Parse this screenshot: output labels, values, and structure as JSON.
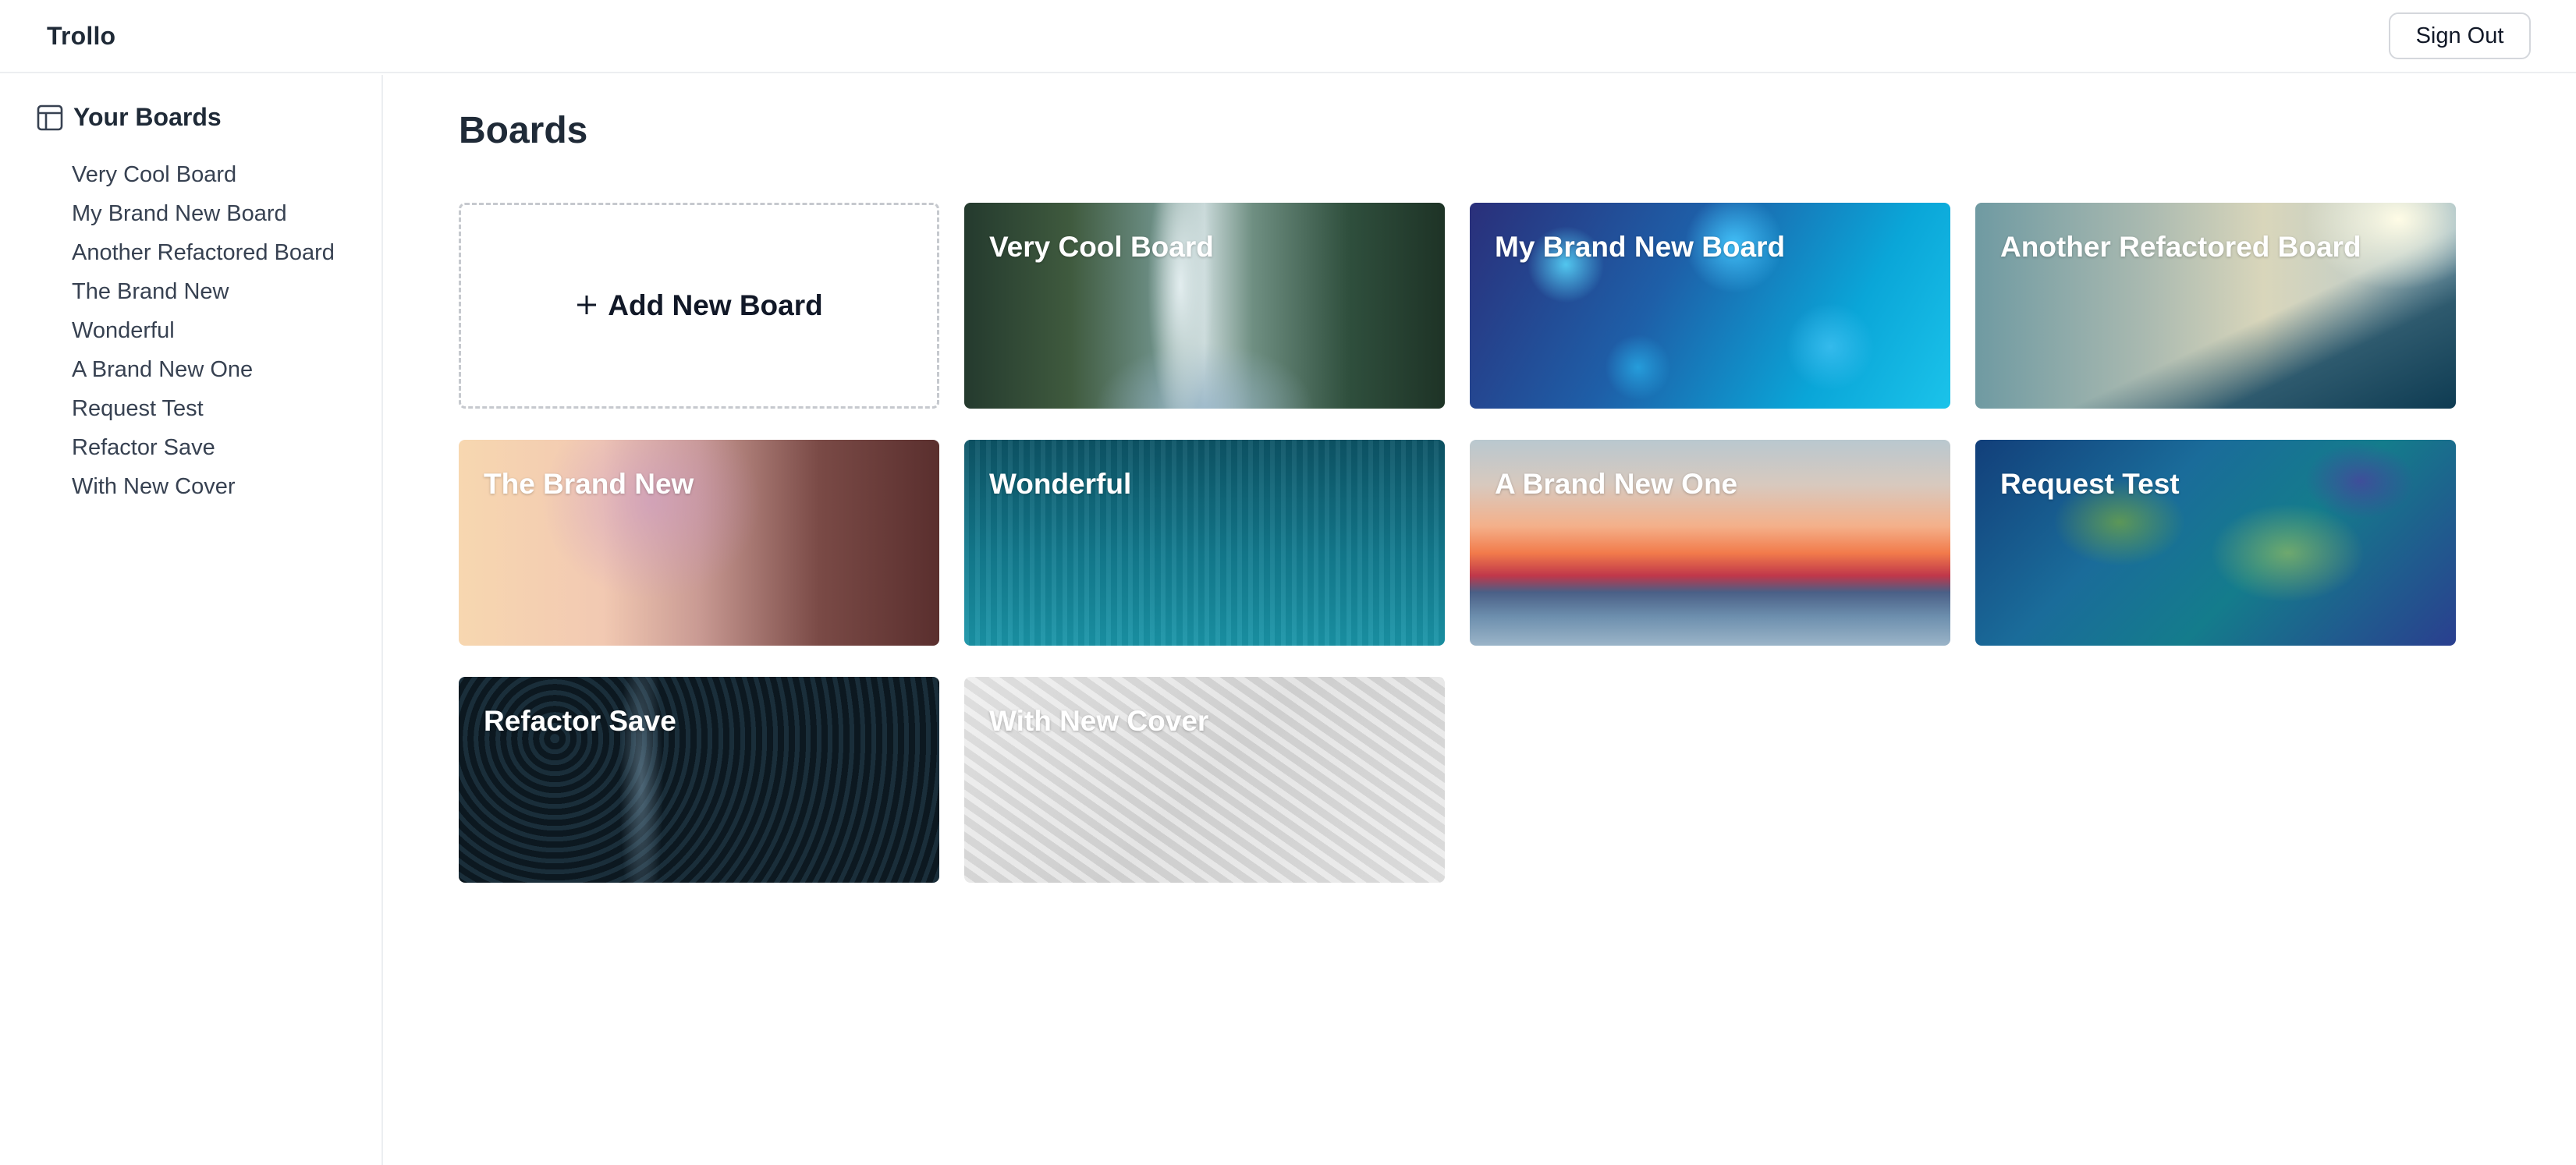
{
  "header": {
    "app_title": "Trollo",
    "sign_out_label": "Sign Out"
  },
  "sidebar": {
    "title": "Your Boards",
    "title_icon": "board-icon",
    "items": [
      {
        "label": "Very Cool Board"
      },
      {
        "label": "My Brand New Board"
      },
      {
        "label": "Another Refactored Board"
      },
      {
        "label": "The Brand New"
      },
      {
        "label": "Wonderful"
      },
      {
        "label": "A Brand New One"
      },
      {
        "label": "Request Test"
      },
      {
        "label": "Refactor Save"
      },
      {
        "label": "With New Cover"
      }
    ]
  },
  "main": {
    "title": "Boards",
    "add_board": {
      "icon": "plus-icon",
      "label": "Add New Board"
    },
    "boards": [
      {
        "title": "Very Cool Board"
      },
      {
        "title": "My Brand New Board"
      },
      {
        "title": "Another Refactored Board"
      },
      {
        "title": "The Brand New"
      },
      {
        "title": "Wonderful"
      },
      {
        "title": "A Brand New One"
      },
      {
        "title": "Request Test"
      },
      {
        "title": "Refactor Save"
      },
      {
        "title": "With New Cover"
      }
    ]
  }
}
